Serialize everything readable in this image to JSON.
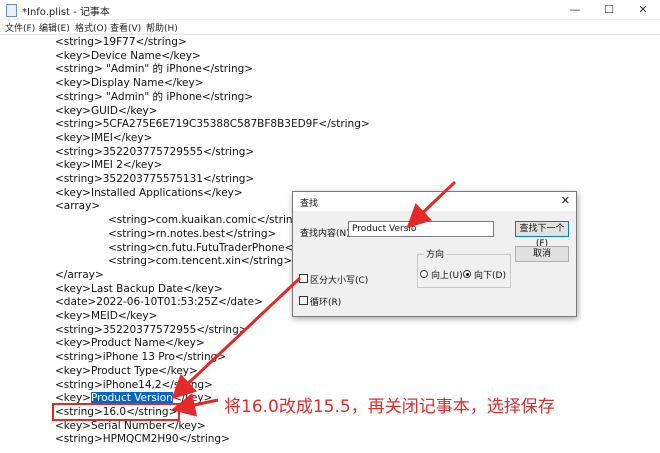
{
  "window": {
    "title": "*Info.plist - 记事本",
    "minimize_glyph": "—",
    "maximize_glyph": "☐",
    "close_glyph": "✕"
  },
  "menu": {
    "file": "文件(F)",
    "edit": "编辑(E)",
    "format": "格式(O)",
    "view": "查看(V)",
    "help": "帮助(H)"
  },
  "editor": {
    "lines": [
      "<string>19F77</string>",
      "<key>Device Name</key>",
      "<string> \"Admin\" 的 iPhone</string>",
      "<key>Display Name</key>",
      "<string> \"Admin\" 的 iPhone</string>",
      "<key>GUID</key>",
      "<string>5CFA275E6E719C35388C587BF8B3ED9F</string>",
      "<key>IMEI</key>",
      "<string>352203775729555</string>",
      "<key>IMEI 2</key>",
      "<string>352203775575131</string>",
      "<key>Installed Applications</key>",
      "<array>",
      "<string>com.kuaikan.comic</string>",
      "<string>rn.notes.best</string>",
      "<string>cn.futu.FutuTraderPhone</s",
      "<string>com.tencent.xin</string>",
      "</array>",
      "<key>Last Backup Date</key>",
      "<date>2022-06-10T01:53:25Z</date>",
      "<key>MEID</key>",
      "<string>35220377572955</string>",
      "<key>Product Name</key>",
      "<string>iPhone 13 Pro</string>",
      "<key>Product Type</key>",
      "<string>iPhone14,2</string>",
      "<key>",
      "Product Version",
      "</key>",
      "<string>16.0</string>",
      "<key>Serial Number</key>",
      "<string>HPMQCM2H90</string>"
    ]
  },
  "find_dialog": {
    "title": "查找",
    "close_glyph": "✕",
    "find_label": "查找内容(N):",
    "find_value": "Product Versio",
    "find_next": "查找下一个(F)",
    "cancel": "取消",
    "direction_label": "方向",
    "up_label": "向上(U)",
    "down_label": "向下(D)",
    "match_case_label": "区分大小写(C)",
    "wrap_label": "循环(R)",
    "direction_selected": "down"
  },
  "annotation": {
    "text": "将16.0改成15.5，再关闭记事本，选择保存",
    "color": "#e62828"
  }
}
